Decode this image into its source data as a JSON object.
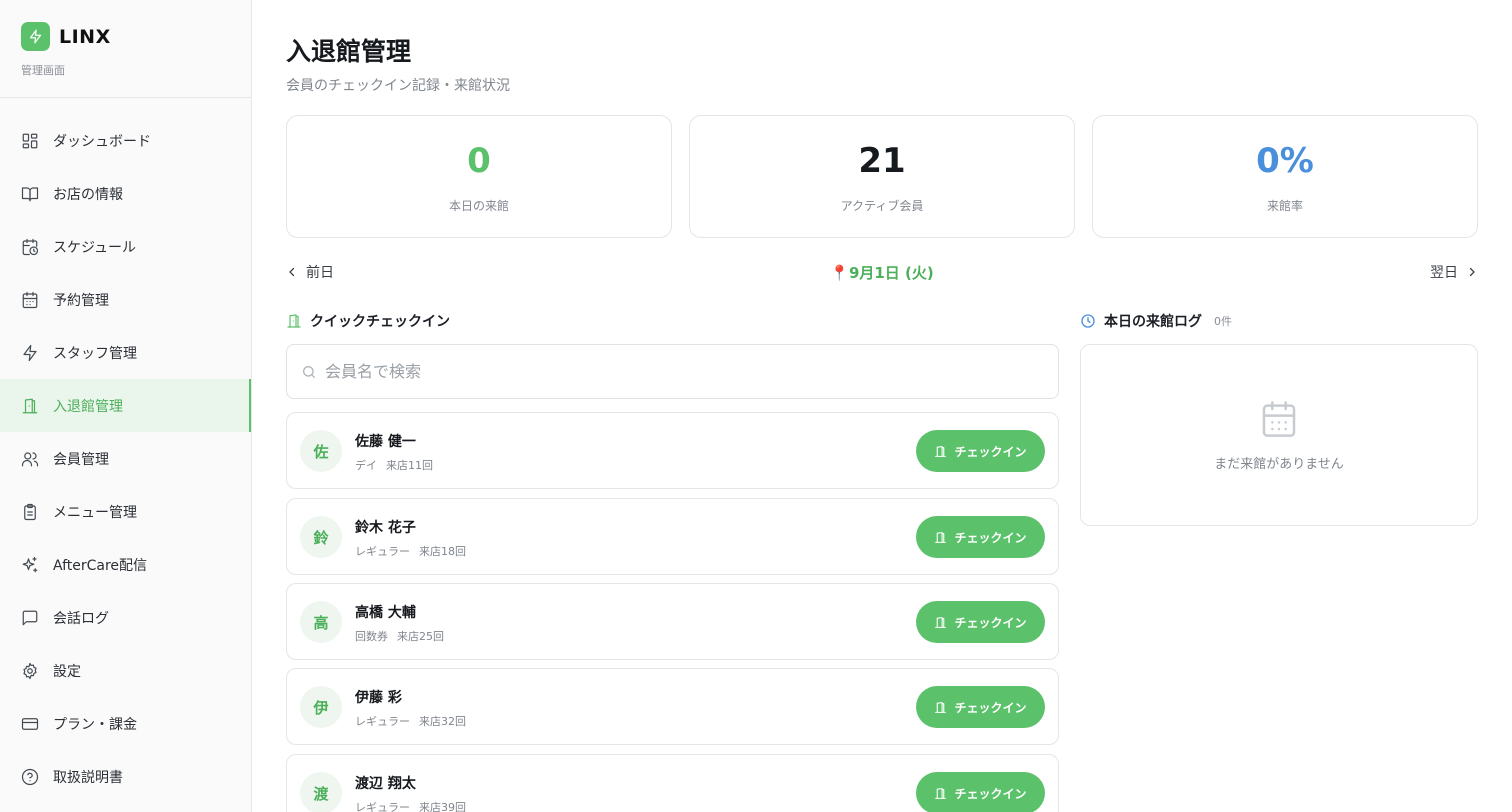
{
  "brand": {
    "name": "LINX",
    "subtitle": "管理画面",
    "accent": "#5cc16b"
  },
  "sidebar": {
    "items": [
      {
        "label": "ダッシュボード",
        "icon": "grid-icon",
        "active": false
      },
      {
        "label": "お店の情報",
        "icon": "book-icon",
        "active": false
      },
      {
        "label": "スケジュール",
        "icon": "calendar-clock-icon",
        "active": false
      },
      {
        "label": "予約管理",
        "icon": "calendar-icon",
        "active": false
      },
      {
        "label": "スタッフ管理",
        "icon": "bolt-icon",
        "active": false
      },
      {
        "label": "入退館管理",
        "icon": "door-icon",
        "active": true
      },
      {
        "label": "会員管理",
        "icon": "users-icon",
        "active": false
      },
      {
        "label": "メニュー管理",
        "icon": "clipboard-icon",
        "active": false
      },
      {
        "label": "AfterCare配信",
        "icon": "sparkles-icon",
        "active": false
      },
      {
        "label": "会話ログ",
        "icon": "chat-icon",
        "active": false
      },
      {
        "label": "設定",
        "icon": "gear-icon",
        "active": false
      },
      {
        "label": "プラン・課金",
        "icon": "credit-card-icon",
        "active": false
      },
      {
        "label": "取扱説明書",
        "icon": "help-circle-icon",
        "active": false
      }
    ]
  },
  "page": {
    "title": "入退館管理",
    "subtitle": "会員のチェックイン記録・来館状況"
  },
  "stats": [
    {
      "value": "0",
      "label": "本日の来館",
      "color": "#5cc16b"
    },
    {
      "value": "21",
      "label": "アクティブ会員",
      "color": "#16191d"
    },
    {
      "value": "0%",
      "label": "来館率",
      "color": "#4a8fdc"
    }
  ],
  "datebar": {
    "prev": "前日",
    "current": "9月1日 (火)",
    "pin": "📍",
    "next": "翌日"
  },
  "quick": {
    "title": "クイックチェックイン",
    "search_placeholder": "会員名で検索",
    "checkin_label": "チェックイン",
    "members": [
      {
        "initial": "佐",
        "name": "佐藤 健一",
        "plan": "デイ",
        "visits": "来店11回"
      },
      {
        "initial": "鈴",
        "name": "鈴木 花子",
        "plan": "レギュラー",
        "visits": "来店18回"
      },
      {
        "initial": "高",
        "name": "高橋 大輔",
        "plan": "回数券",
        "visits": "来店25回"
      },
      {
        "initial": "伊",
        "name": "伊藤 彩",
        "plan": "レギュラー",
        "visits": "来店32回"
      },
      {
        "initial": "渡",
        "name": "渡辺 翔太",
        "plan": "レギュラー",
        "visits": "来店39回"
      }
    ]
  },
  "log": {
    "title": "本日の来館ログ",
    "count": "0件",
    "empty": "まだ来館がありません"
  }
}
